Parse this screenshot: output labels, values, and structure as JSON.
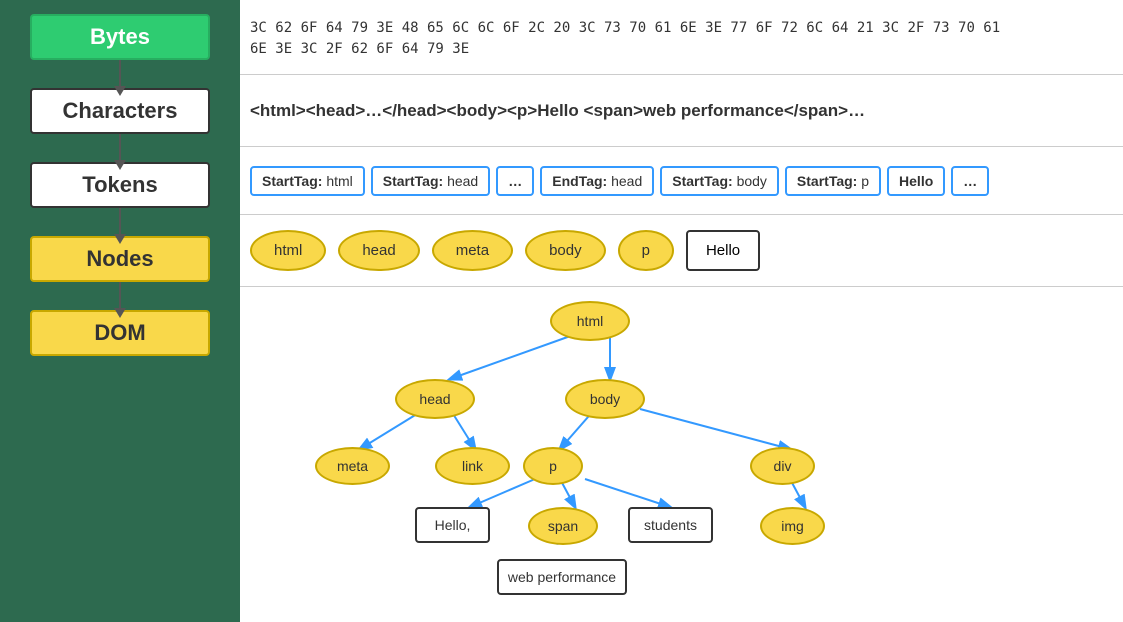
{
  "pipeline": {
    "bytes_label": "Bytes",
    "characters_label": "Characters",
    "tokens_label": "Tokens",
    "nodes_label": "Nodes",
    "dom_label": "DOM"
  },
  "bytes_row": {
    "text": "3C 62 6F 64 79 3E 48 65 6C 6C 6F 2C 20 3C 73 70 61 6E 3E 77 6F 72 6C 64 21 3C 2F 73 70 61\n6E 3E 3C 2F 62 6F 64 79 3E"
  },
  "characters_row": {
    "text": "<html><head>…</head><body><p>Hello <span>web performance</span>…"
  },
  "tokens": [
    {
      "type": "StartTag",
      "value": "html",
      "kind": "box"
    },
    {
      "type": "StartTag",
      "value": "head",
      "kind": "box"
    },
    {
      "type": "...",
      "value": "",
      "kind": "ellipsis"
    },
    {
      "type": "EndTag",
      "value": "head",
      "kind": "box"
    },
    {
      "type": "StartTag",
      "value": "body",
      "kind": "box"
    },
    {
      "type": "StartTag",
      "value": "p",
      "kind": "box"
    },
    {
      "type": "Hello",
      "value": "",
      "kind": "text"
    },
    {
      "type": "...",
      "value": "",
      "kind": "ellipsis"
    }
  ],
  "nodes": [
    {
      "label": "html",
      "kind": "oval"
    },
    {
      "label": "head",
      "kind": "oval"
    },
    {
      "label": "meta",
      "kind": "oval"
    },
    {
      "label": "body",
      "kind": "oval"
    },
    {
      "label": "p",
      "kind": "oval"
    },
    {
      "label": "Hello",
      "kind": "box"
    }
  ],
  "dom_nodes": {
    "html": {
      "label": "html"
    },
    "head": {
      "label": "head"
    },
    "body": {
      "label": "body"
    },
    "meta": {
      "label": "meta"
    },
    "link": {
      "label": "link"
    },
    "p": {
      "label": "p"
    },
    "div": {
      "label": "div"
    },
    "hello": {
      "label": "Hello,"
    },
    "span": {
      "label": "span"
    },
    "students": {
      "label": "students"
    },
    "img": {
      "label": "img"
    },
    "webperf": {
      "label": "web performance"
    }
  }
}
